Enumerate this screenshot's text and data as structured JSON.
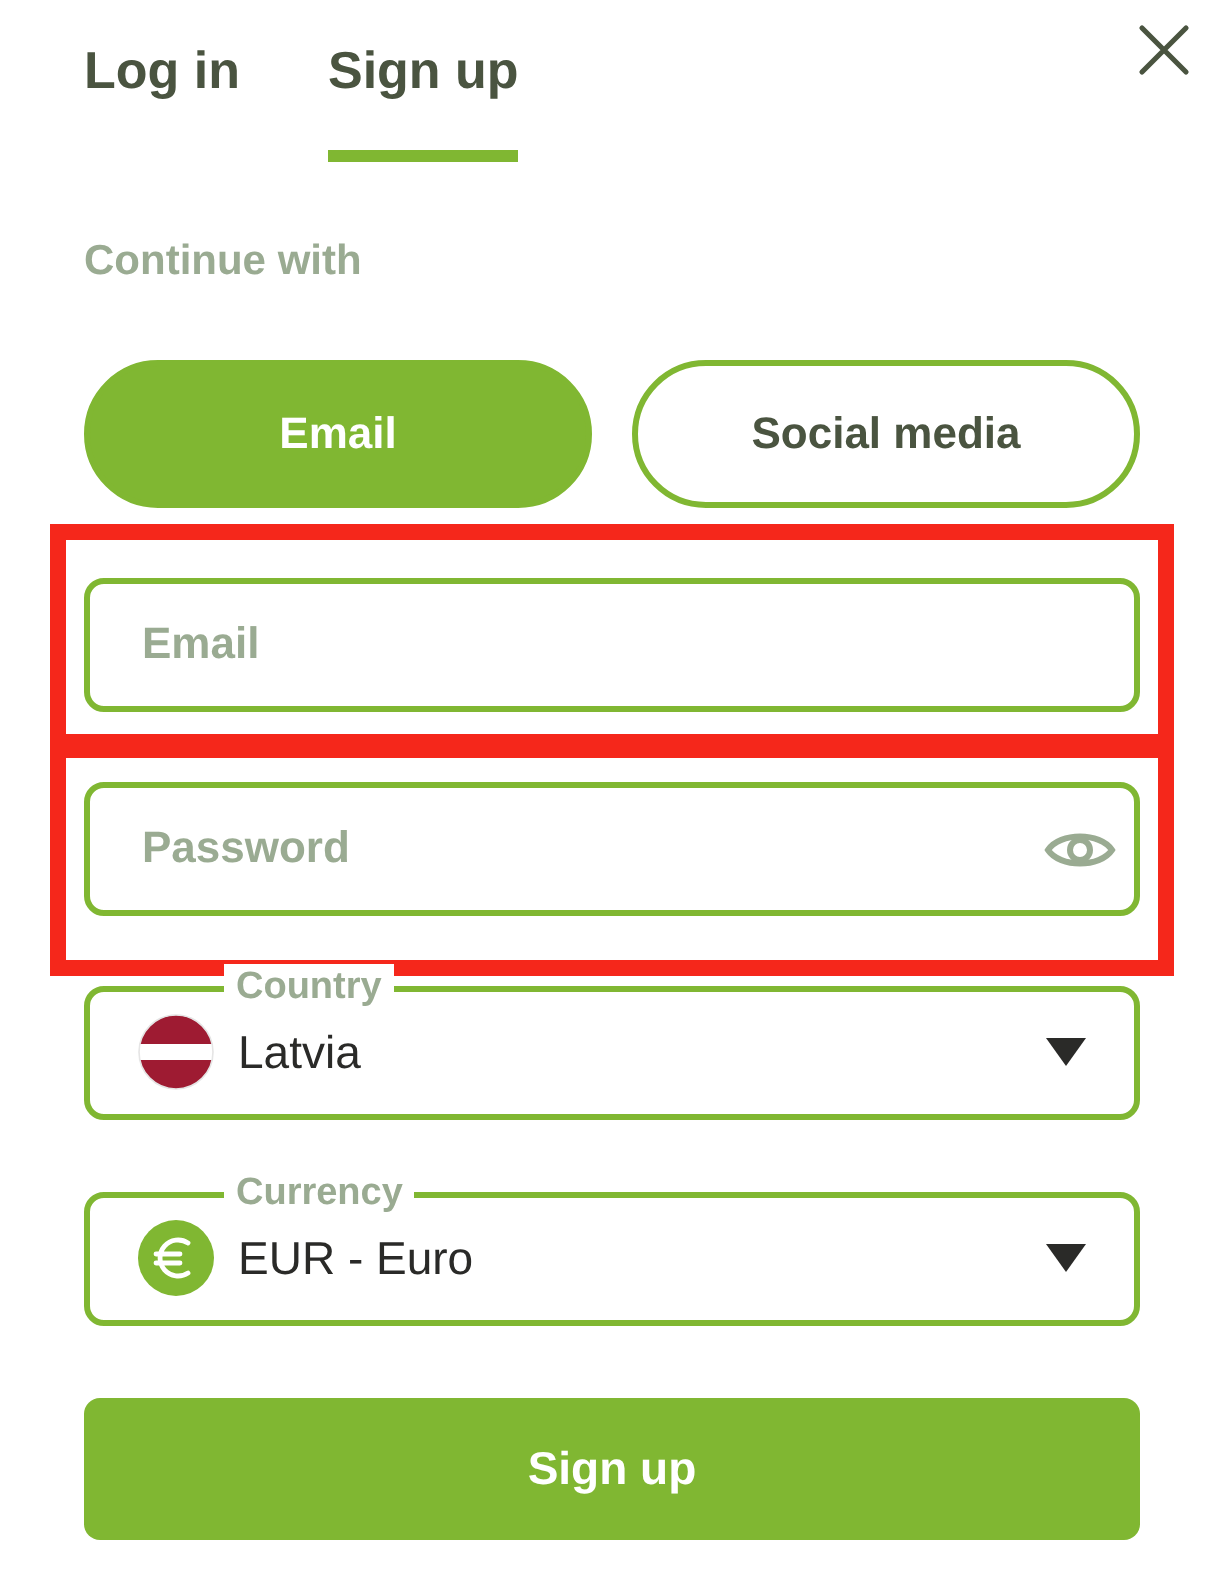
{
  "tabs": [
    {
      "label": "Log in",
      "selected": false
    },
    {
      "label": "Sign up",
      "selected": true
    }
  ],
  "prompt": "Continue with",
  "methods": [
    {
      "label": "Email",
      "selected": true
    },
    {
      "label": "Social media",
      "selected": false
    }
  ],
  "fields": [
    {
      "placeholder": "Email",
      "kind": "text"
    },
    {
      "placeholder": "Password",
      "kind": "password"
    }
  ],
  "selects": [
    {
      "label": "Country",
      "value": "Latvia",
      "kind": "flag"
    },
    {
      "label": "Currency",
      "value": "EUR - Euro",
      "kind": "currency"
    }
  ],
  "submit": "Sign up"
}
